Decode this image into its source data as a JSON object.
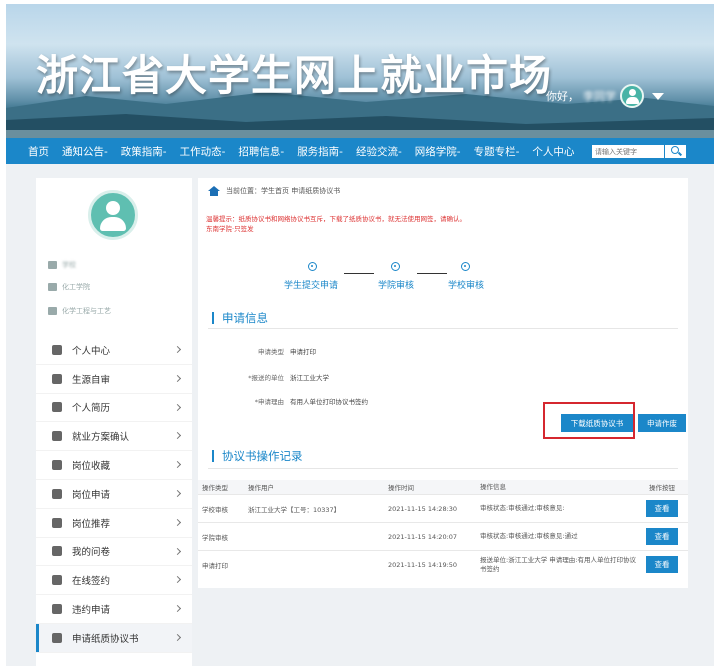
{
  "banner": {
    "title": "浙江省大学生网上就业市场",
    "greeting": "你好，",
    "user_name": "李同学"
  },
  "nav": {
    "items": [
      "首页",
      "通知公告-",
      "政策指南-",
      "工作动态-",
      "招聘信息-",
      "服务指南-",
      "经验交流-",
      "网络学院-",
      "专题专栏-",
      "个人中心"
    ],
    "search_placeholder": "请输入关键字"
  },
  "sidebar": {
    "info": [
      "学校",
      "化工学院",
      "化学工程与工艺"
    ],
    "menu": [
      {
        "label": "个人中心",
        "active": false
      },
      {
        "label": "生源自审",
        "active": false
      },
      {
        "label": "个人简历",
        "active": false
      },
      {
        "label": "就业方案确认",
        "active": false
      },
      {
        "label": "岗位收藏",
        "active": false
      },
      {
        "label": "岗位申请",
        "active": false
      },
      {
        "label": "岗位推荐",
        "active": false
      },
      {
        "label": "我的问卷",
        "active": false
      },
      {
        "label": "在线签约",
        "active": false
      },
      {
        "label": "违约申请",
        "active": false
      },
      {
        "label": "申请纸质协议书",
        "active": true
      }
    ]
  },
  "main": {
    "breadcrumb": "当前位置：学生首页 申请纸质协议书",
    "notice_lines": [
      "温馨提示：纸质协议书和网络协议书互斥，下载了纸质协议书，就无法使用网签，请确认。",
      "东南学院·只签发"
    ],
    "steps": [
      "学生提交申请",
      "学院审核",
      "学校审核"
    ],
    "apply_section_title": "申请信息",
    "form": [
      {
        "label": "申请类型",
        "value": "申请打印"
      },
      {
        "label": "*报送的单位",
        "value": "浙江工业大学"
      },
      {
        "label": "*申请理由",
        "value": "有用人单位打印协议书签约"
      }
    ],
    "download_button": "下载纸质协议书",
    "apply_button": "申请作废",
    "records_section_title": "协议书操作记录",
    "table": {
      "headers": [
        "操作类型",
        "操作用户",
        "操作时间",
        "操作信息",
        "操作按钮"
      ],
      "rows": [
        {
          "type": "学校审核",
          "user": "浙江工业大学【工号：10337】",
          "time": "2021-11-15 14:28:30",
          "info": "审核状态:审核通过;审核意见:",
          "action": "查看"
        },
        {
          "type": "学院审核",
          "user": "",
          "time": "2021-11-15 14:20:07",
          "info": "审核状态:审核通过;审核意见:通过",
          "action": "查看"
        },
        {
          "type": "申请打印",
          "user": "",
          "time": "2021-11-15 14:19:50",
          "info": "报送单位:浙江工业大学 申请理由:有用人单位打印协议书签约",
          "action": "查看"
        }
      ]
    }
  }
}
